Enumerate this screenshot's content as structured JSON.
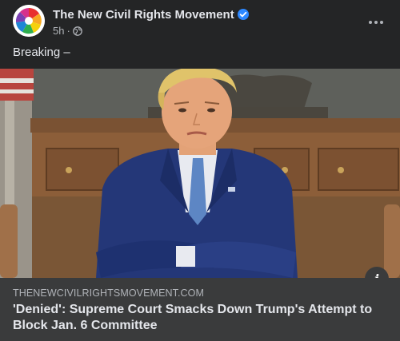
{
  "post": {
    "page_name": "The New Civil Rights Movement",
    "time": "5h",
    "separator": "·",
    "text": "Breaking –",
    "privacy_icon": "globe-icon",
    "verified_icon": "verified-badge-icon",
    "more_icon": "more-options-icon"
  },
  "link": {
    "domain": "THENEWCIVILRIGHTSMOVEMENT.COM",
    "title": "'Denied': Supreme Court Smacks Down Trump's Attempt to Block Jan. 6 Committee",
    "info_label": "i"
  },
  "colors": {
    "background": "#242526",
    "link_box": "#3a3b3c",
    "verified": "#2d88ff",
    "text_primary": "#e4e6eb",
    "text_secondary": "#b0b3b8"
  }
}
